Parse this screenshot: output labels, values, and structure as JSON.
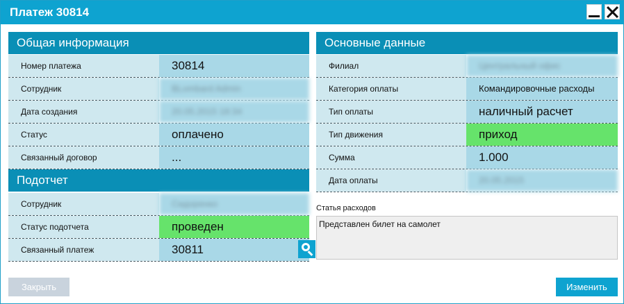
{
  "window": {
    "title": "Платеж 30814"
  },
  "general": {
    "header": "Общая информация",
    "rows": [
      {
        "label": "Номер платежа",
        "value": "30814"
      },
      {
        "label": "Сотрудник",
        "value": "BLombard Admin"
      },
      {
        "label": "Дата создания",
        "value": "20.05.2015 18:34"
      },
      {
        "label": "Статус",
        "value": "оплачено"
      },
      {
        "label": "Связанный договор",
        "value": "..."
      }
    ]
  },
  "report": {
    "header": "Подотчет",
    "rows": [
      {
        "label": "Сотрудник",
        "value": "Сидоренко"
      },
      {
        "label": "Статус подотчета",
        "value": "проведен"
      },
      {
        "label": "Связанный платеж",
        "value": "30811"
      }
    ]
  },
  "main_data": {
    "header": "Основные данные",
    "rows": [
      {
        "label": "Филиал",
        "value": "Центральный офис"
      },
      {
        "label": "Категория оплаты",
        "value": "Командировочные расходы"
      },
      {
        "label": "Тип оплаты",
        "value": "наличный расчет"
      },
      {
        "label": "Тип движения",
        "value": "приход"
      },
      {
        "label": "Сумма",
        "value": "1.000"
      },
      {
        "label": "Дата оплаты",
        "value": "20.05.2015"
      }
    ]
  },
  "expense": {
    "label": "Статья расходов",
    "text": "Представлен билет на самолет"
  },
  "buttons": {
    "close": "Закрыть",
    "edit": "Изменить"
  },
  "colors": {
    "accent": "#0ea3d0",
    "header": "#0a8fb6",
    "label_bg": "#cfe8ef",
    "value_bg": "#a9d8e7",
    "green": "#66e36b"
  }
}
